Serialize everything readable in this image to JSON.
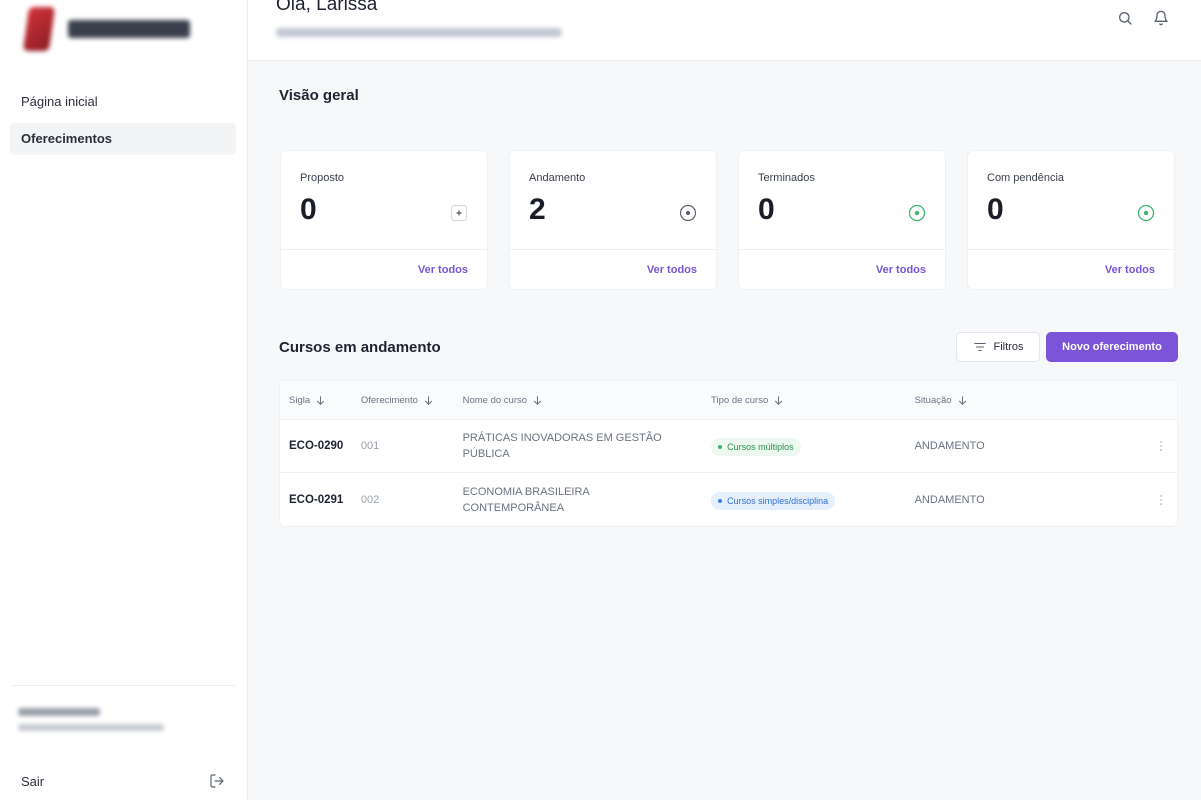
{
  "sidebar": {
    "nav": [
      {
        "label": "Página inicial"
      },
      {
        "label": "Oferecimentos"
      }
    ],
    "logout_label": "Sair"
  },
  "header": {
    "greeting": "Olá, Larissa"
  },
  "overview": {
    "title": "Visão geral",
    "cards": [
      {
        "label": "Proposto",
        "value": "0",
        "link": "Ver todos",
        "icon": "plus-square-icon",
        "icon_color": "#9aa0ab"
      },
      {
        "label": "Andamento",
        "value": "2",
        "link": "Ver todos",
        "icon": "play-circle-icon",
        "icon_color": "#5b6070"
      },
      {
        "label": "Terminados",
        "value": "0",
        "link": "Ver todos",
        "icon": "check-circle-icon",
        "icon_color": "#38b36a"
      },
      {
        "label": "Com pendência",
        "value": "0",
        "link": "Ver todos",
        "icon": "check-circle-icon",
        "icon_color": "#38b36a"
      }
    ]
  },
  "courses": {
    "title": "Cursos em andamento",
    "filter_label": "Filtros",
    "new_label": "Novo oferecimento",
    "columns": [
      "Sigla",
      "Oferecimento",
      "Nome do curso",
      "Tipo de curso",
      "Situação"
    ],
    "rows": [
      {
        "sigla": "ECO-0290",
        "oferecimento": "001",
        "nome": "PRÁTICAS INOVADORAS EM GESTÃO PÚBLICA",
        "tipo": "Cursos múltiplos",
        "tipo_color": "green",
        "situacao": "ANDAMENTO"
      },
      {
        "sigla": "ECO-0291",
        "oferecimento": "002",
        "nome": "ECONOMIA BRASILEIRA CONTEMPORÂNEA",
        "tipo": "Cursos simples/disciplina",
        "tipo_color": "blue",
        "situacao": "ANDAMENTO"
      }
    ]
  },
  "colors": {
    "accent": "#7c54d8",
    "link": "#7a54d6"
  }
}
